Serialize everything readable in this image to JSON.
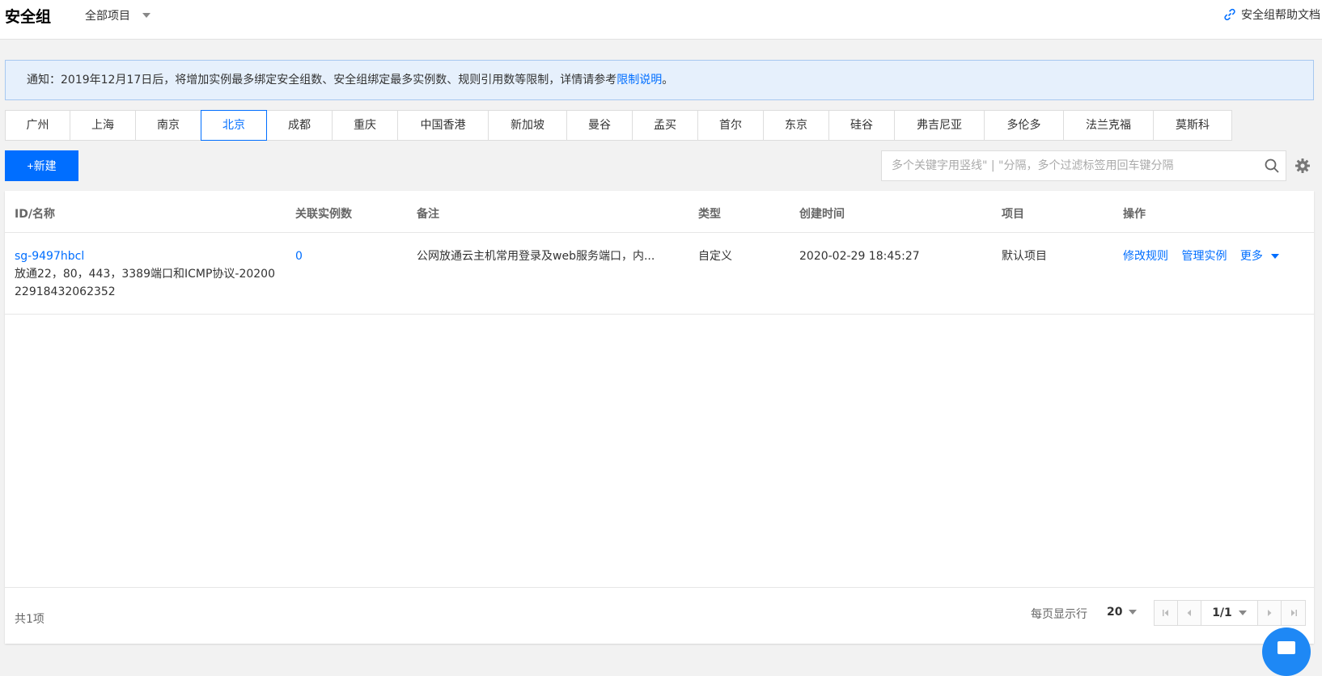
{
  "header": {
    "title": "安全组",
    "project_select": "全部项目",
    "help_link": "安全组帮助文档",
    "help_icon": "link-icon"
  },
  "notice": {
    "text": "通知：2019年12月17日后，将增加实例最多绑定安全组数、安全组绑定最多实例数、规则引用数等限制，详情请参考",
    "link": "限制说明",
    "suffix": "。"
  },
  "regions": {
    "active": "北京",
    "items": [
      {
        "label": "广州"
      },
      {
        "label": "上海"
      },
      {
        "label": "南京"
      },
      {
        "label": "北京"
      },
      {
        "label": "成都"
      },
      {
        "label": "重庆"
      },
      {
        "label": "中国香港"
      },
      {
        "label": "新加坡"
      },
      {
        "label": "曼谷"
      },
      {
        "label": "孟买"
      },
      {
        "label": "首尔"
      },
      {
        "label": "东京"
      },
      {
        "label": "硅谷"
      },
      {
        "label": "弗吉尼亚"
      },
      {
        "label": "多伦多"
      },
      {
        "label": "法兰克福"
      },
      {
        "label": "莫斯科"
      }
    ]
  },
  "toolbar": {
    "new_label": "+新建",
    "search_placeholder": "多个关键字用竖线\" | \"分隔，多个过滤标签用回车键分隔",
    "search_icon": "search-icon",
    "settings_icon": "gear-icon"
  },
  "table": {
    "headers": {
      "id_name": "ID/名称",
      "instances": "关联实例数",
      "remark": "备注",
      "type": "类型",
      "created": "创建时间",
      "project": "项目",
      "actions": "操作"
    },
    "rows": [
      {
        "id": "sg-9497hbcl",
        "name": "放通22，80，443，3389端口和ICMP协议-2020022918432062352",
        "instances": "0",
        "remark": "公网放通云主机常用登录及web服务端口，内...",
        "type": "自定义",
        "created": "2020-02-29 18:45:27",
        "project": "默认项目",
        "action_edit": "修改规则",
        "action_manage": "管理实例",
        "action_more": "更多"
      }
    ]
  },
  "footer": {
    "total": "共1项",
    "page_size_label": "每页显示行",
    "page_size": "20",
    "page_indicator": "1/1"
  },
  "colors": {
    "accent": "#006eff",
    "notice_bg": "#e6f0fc",
    "page_bg": "#f2f2f2"
  }
}
